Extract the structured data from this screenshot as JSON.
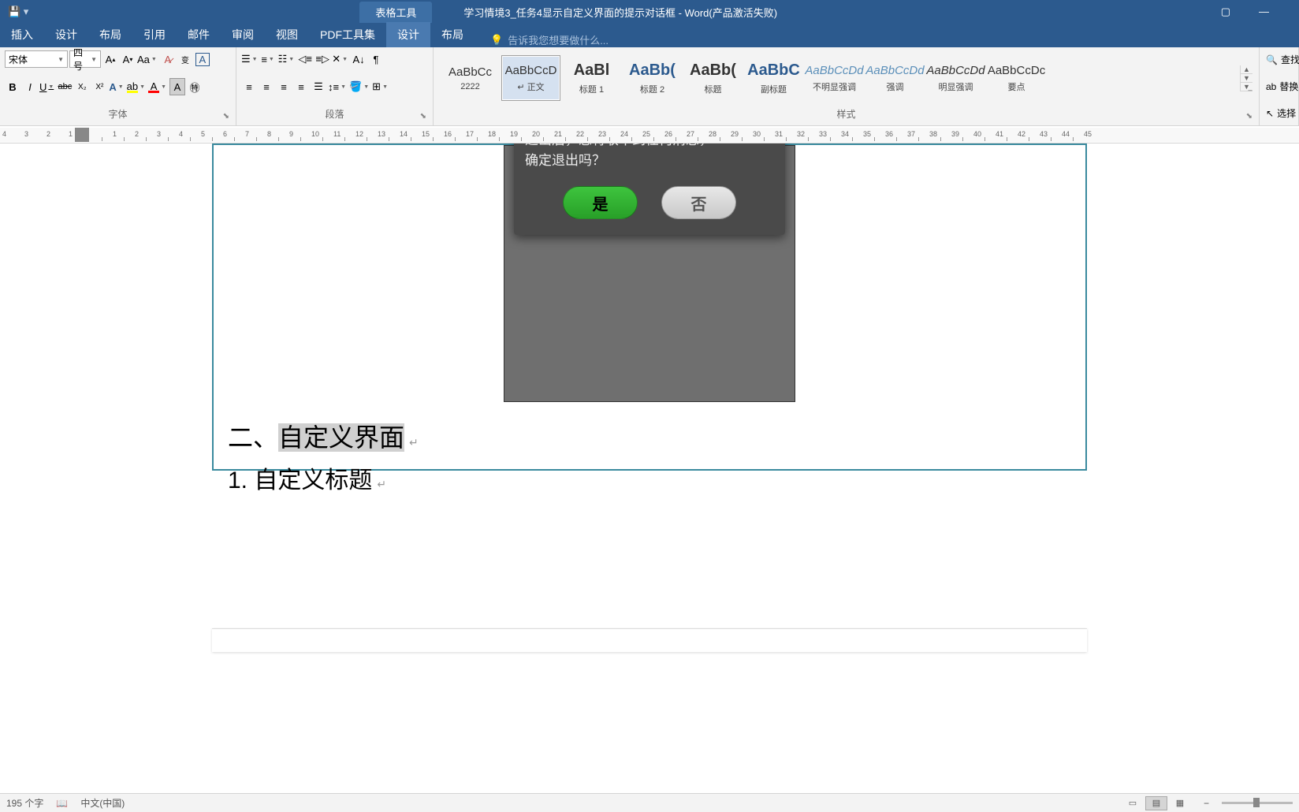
{
  "title_bar": {
    "tools_tab": "表格工具",
    "doc_title": "学习情境3_任务4显示自定义界面的提示对话框 - Word(产品激活失败)"
  },
  "tabs": {
    "items": [
      "插入",
      "设计",
      "布局",
      "引用",
      "邮件",
      "审阅",
      "视图",
      "PDF工具集",
      "设计",
      "布局"
    ],
    "tell_me": "告诉我您想要做什么..."
  },
  "font": {
    "name": "宋体",
    "size": "四号",
    "group_label": "字体"
  },
  "paragraph": {
    "group_label": "段落"
  },
  "styles": {
    "group_label": "样式",
    "items": [
      {
        "preview": "AaBbCc",
        "name": "2222",
        "cls": ""
      },
      {
        "preview": "AaBbCcD",
        "name": "↵ 正文",
        "cls": ""
      },
      {
        "preview": "AaBl",
        "name": "标题 1",
        "cls": "big"
      },
      {
        "preview": "AaBb(",
        "name": "标题 2",
        "cls": "big blue"
      },
      {
        "preview": "AaBb(",
        "name": "标题",
        "cls": "big"
      },
      {
        "preview": "AaBbC",
        "name": "副标题",
        "cls": "big blue"
      },
      {
        "preview": "AaBbCcDd",
        "name": "不明显强调",
        "cls": "ital"
      },
      {
        "preview": "AaBbCcDd",
        "name": "强调",
        "cls": "ital"
      },
      {
        "preview": "AaBbCcDd",
        "name": "明显强调",
        "cls": "dark-ital"
      },
      {
        "preview": "AaBbCcDc",
        "name": "要点",
        "cls": ""
      }
    ]
  },
  "edit": {
    "find": "查找",
    "replace": "替换",
    "select": "选择"
  },
  "document": {
    "android": {
      "line1": "退出后，您将收不到任何消息，",
      "line2": "确定退出吗？",
      "yes": "是",
      "no": "否"
    },
    "heading_prefix": "二、",
    "heading_highlight": "自定义界面",
    "subheading": "1. 自定义标题"
  },
  "status": {
    "words": "195 个字",
    "lang": "中文(中国)"
  },
  "ruler": {
    "left": [
      4,
      3,
      2,
      1
    ],
    "main": [
      1,
      2,
      3,
      4,
      5,
      6,
      7,
      8,
      9,
      10,
      11,
      12,
      13,
      14,
      15,
      16,
      17,
      18,
      19,
      20,
      21,
      22,
      23,
      24,
      25,
      26,
      27,
      28,
      29,
      30,
      31,
      32,
      33,
      34,
      35,
      36,
      37,
      38,
      39,
      40,
      41,
      42,
      43,
      44,
      45
    ]
  }
}
